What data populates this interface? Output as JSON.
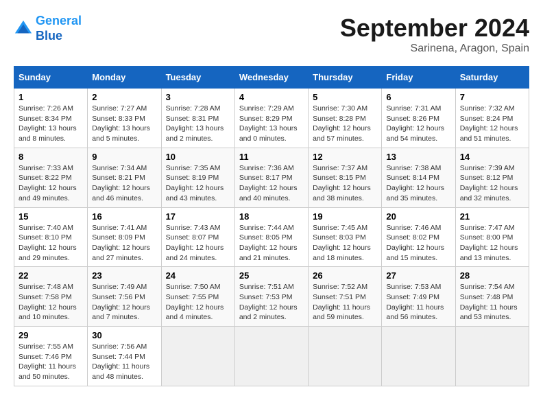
{
  "header": {
    "logo_line1": "General",
    "logo_line2": "Blue",
    "month_title": "September 2024",
    "location": "Sarinena, Aragon, Spain"
  },
  "days_of_week": [
    "Sunday",
    "Monday",
    "Tuesday",
    "Wednesday",
    "Thursday",
    "Friday",
    "Saturday"
  ],
  "weeks": [
    [
      {
        "day": "1",
        "info": "Sunrise: 7:26 AM\nSunset: 8:34 PM\nDaylight: 13 hours and 8 minutes."
      },
      {
        "day": "2",
        "info": "Sunrise: 7:27 AM\nSunset: 8:33 PM\nDaylight: 13 hours and 5 minutes."
      },
      {
        "day": "3",
        "info": "Sunrise: 7:28 AM\nSunset: 8:31 PM\nDaylight: 13 hours and 2 minutes."
      },
      {
        "day": "4",
        "info": "Sunrise: 7:29 AM\nSunset: 8:29 PM\nDaylight: 13 hours and 0 minutes."
      },
      {
        "day": "5",
        "info": "Sunrise: 7:30 AM\nSunset: 8:28 PM\nDaylight: 12 hours and 57 minutes."
      },
      {
        "day": "6",
        "info": "Sunrise: 7:31 AM\nSunset: 8:26 PM\nDaylight: 12 hours and 54 minutes."
      },
      {
        "day": "7",
        "info": "Sunrise: 7:32 AM\nSunset: 8:24 PM\nDaylight: 12 hours and 51 minutes."
      }
    ],
    [
      {
        "day": "8",
        "info": "Sunrise: 7:33 AM\nSunset: 8:22 PM\nDaylight: 12 hours and 49 minutes."
      },
      {
        "day": "9",
        "info": "Sunrise: 7:34 AM\nSunset: 8:21 PM\nDaylight: 12 hours and 46 minutes."
      },
      {
        "day": "10",
        "info": "Sunrise: 7:35 AM\nSunset: 8:19 PM\nDaylight: 12 hours and 43 minutes."
      },
      {
        "day": "11",
        "info": "Sunrise: 7:36 AM\nSunset: 8:17 PM\nDaylight: 12 hours and 40 minutes."
      },
      {
        "day": "12",
        "info": "Sunrise: 7:37 AM\nSunset: 8:15 PM\nDaylight: 12 hours and 38 minutes."
      },
      {
        "day": "13",
        "info": "Sunrise: 7:38 AM\nSunset: 8:14 PM\nDaylight: 12 hours and 35 minutes."
      },
      {
        "day": "14",
        "info": "Sunrise: 7:39 AM\nSunset: 8:12 PM\nDaylight: 12 hours and 32 minutes."
      }
    ],
    [
      {
        "day": "15",
        "info": "Sunrise: 7:40 AM\nSunset: 8:10 PM\nDaylight: 12 hours and 29 minutes."
      },
      {
        "day": "16",
        "info": "Sunrise: 7:41 AM\nSunset: 8:09 PM\nDaylight: 12 hours and 27 minutes."
      },
      {
        "day": "17",
        "info": "Sunrise: 7:43 AM\nSunset: 8:07 PM\nDaylight: 12 hours and 24 minutes."
      },
      {
        "day": "18",
        "info": "Sunrise: 7:44 AM\nSunset: 8:05 PM\nDaylight: 12 hours and 21 minutes."
      },
      {
        "day": "19",
        "info": "Sunrise: 7:45 AM\nSunset: 8:03 PM\nDaylight: 12 hours and 18 minutes."
      },
      {
        "day": "20",
        "info": "Sunrise: 7:46 AM\nSunset: 8:02 PM\nDaylight: 12 hours and 15 minutes."
      },
      {
        "day": "21",
        "info": "Sunrise: 7:47 AM\nSunset: 8:00 PM\nDaylight: 12 hours and 13 minutes."
      }
    ],
    [
      {
        "day": "22",
        "info": "Sunrise: 7:48 AM\nSunset: 7:58 PM\nDaylight: 12 hours and 10 minutes."
      },
      {
        "day": "23",
        "info": "Sunrise: 7:49 AM\nSunset: 7:56 PM\nDaylight: 12 hours and 7 minutes."
      },
      {
        "day": "24",
        "info": "Sunrise: 7:50 AM\nSunset: 7:55 PM\nDaylight: 12 hours and 4 minutes."
      },
      {
        "day": "25",
        "info": "Sunrise: 7:51 AM\nSunset: 7:53 PM\nDaylight: 12 hours and 2 minutes."
      },
      {
        "day": "26",
        "info": "Sunrise: 7:52 AM\nSunset: 7:51 PM\nDaylight: 11 hours and 59 minutes."
      },
      {
        "day": "27",
        "info": "Sunrise: 7:53 AM\nSunset: 7:49 PM\nDaylight: 11 hours and 56 minutes."
      },
      {
        "day": "28",
        "info": "Sunrise: 7:54 AM\nSunset: 7:48 PM\nDaylight: 11 hours and 53 minutes."
      }
    ],
    [
      {
        "day": "29",
        "info": "Sunrise: 7:55 AM\nSunset: 7:46 PM\nDaylight: 11 hours and 50 minutes."
      },
      {
        "day": "30",
        "info": "Sunrise: 7:56 AM\nSunset: 7:44 PM\nDaylight: 11 hours and 48 minutes."
      },
      {
        "day": "",
        "info": ""
      },
      {
        "day": "",
        "info": ""
      },
      {
        "day": "",
        "info": ""
      },
      {
        "day": "",
        "info": ""
      },
      {
        "day": "",
        "info": ""
      }
    ]
  ]
}
